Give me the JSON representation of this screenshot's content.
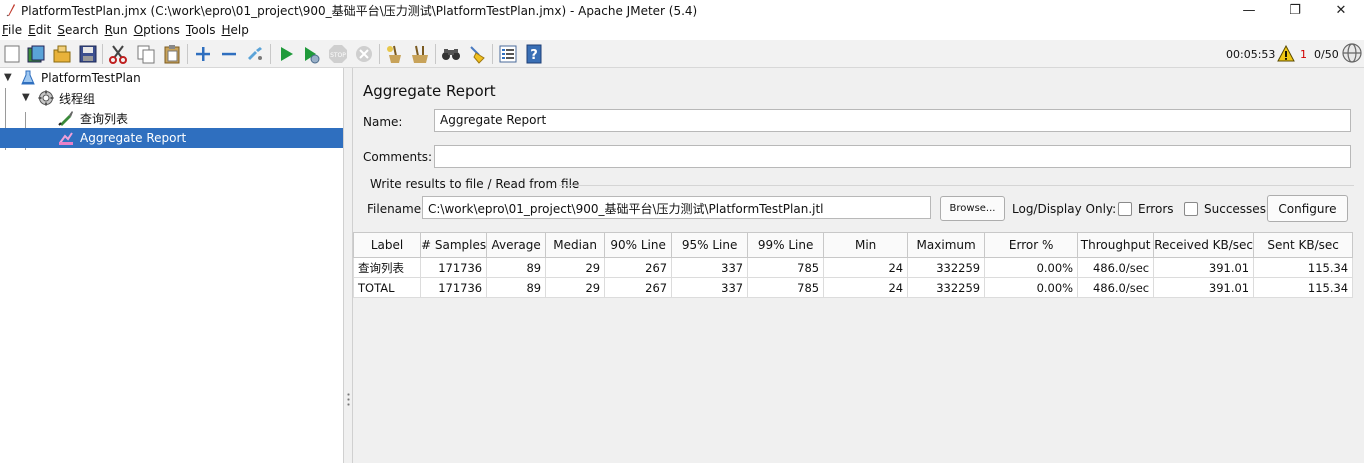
{
  "window": {
    "title": "PlatformTestPlan.jmx (C:\\work\\epro\\01_project\\900_基础平台\\压力测试\\PlatformTestPlan.jmx) - Apache JMeter (5.4)",
    "min_glyph": "—",
    "max_glyph": "❐",
    "close_glyph": "✕"
  },
  "menu": [
    {
      "mnemonic": "F",
      "rest": "ile"
    },
    {
      "mnemonic": "E",
      "rest": "dit"
    },
    {
      "mnemonic": "S",
      "rest": "earch"
    },
    {
      "mnemonic": "R",
      "rest": "un"
    },
    {
      "mnemonic": "O",
      "rest": "ptions"
    },
    {
      "mnemonic": "T",
      "rest": "ools"
    },
    {
      "mnemonic": "H",
      "rest": "elp"
    }
  ],
  "toolbar": {
    "elapsed_time": "00:05:53",
    "warning_count": "1",
    "threads": "0/50",
    "icons": [
      "new-icon",
      "templates-icon",
      "open-icon",
      "save-icon",
      "cut-icon",
      "copy-icon",
      "paste-icon",
      "expand-icon",
      "collapse-icon",
      "toggle-icon",
      "start-icon",
      "start-no-pauses-icon",
      "stop-icon",
      "shutdown-icon",
      "clear-icon",
      "clear-all-icon",
      "search-icon",
      "reset-search-icon",
      "function-helper-icon",
      "help-icon"
    ]
  },
  "tree": {
    "items": [
      {
        "label": "PlatformTestPlan",
        "icon": "test-plan-icon"
      },
      {
        "label": "线程组",
        "icon": "thread-group-icon"
      },
      {
        "label": "查询列表",
        "icon": "http-sampler-icon"
      },
      {
        "label": "Aggregate Report",
        "icon": "listener-icon"
      }
    ]
  },
  "panel": {
    "title": "Aggregate Report",
    "name_label": "Name:",
    "name_value": "Aggregate Report",
    "comments_label": "Comments:",
    "comments_value": "",
    "file_group_title": "Write results to file / Read from file",
    "filename_label": "Filename",
    "filename_value": "C:\\work\\epro\\01_project\\900_基础平台\\压力测试\\PlatformTestPlan.jtl",
    "browse_label": "Browse...",
    "log_display_label": "Log/Display Only:",
    "errors_label": "Errors",
    "successes_label": "Successes",
    "configure_label": "Configure"
  },
  "table": {
    "columns": [
      "Label",
      "# Samples",
      "Average",
      "Median",
      "90% Line",
      "95% Line",
      "99% Line",
      "Min",
      "Maximum",
      "Error %",
      "Throughput",
      "Received KB/sec",
      "Sent KB/sec"
    ],
    "rows": [
      [
        "查询列表",
        "171736",
        "89",
        "29",
        "267",
        "337",
        "785",
        "24",
        "332259",
        "0.00%",
        "486.0/sec",
        "391.01",
        "115.34"
      ],
      [
        "TOTAL",
        "171736",
        "89",
        "29",
        "267",
        "337",
        "785",
        "24",
        "332259",
        "0.00%",
        "486.0/sec",
        "391.01",
        "115.34"
      ]
    ]
  }
}
